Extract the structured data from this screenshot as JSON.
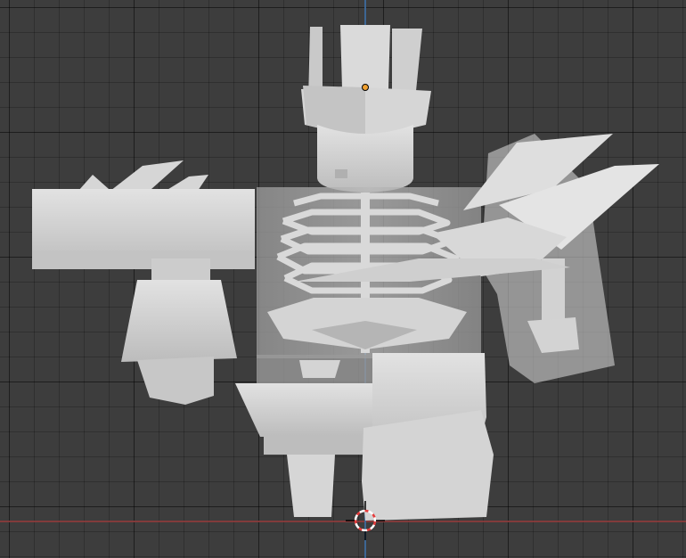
{
  "viewport": {
    "background_color": "#3d3d3d",
    "grid_color": "#2f2f2f",
    "x_axis_color": "#8a3b3b",
    "z_axis_color": "#3d6a9d"
  },
  "scene": {
    "model_color": "#d0d0d0",
    "model_shadow_color": "#a9a9a9",
    "origin_point_color": "#f0a030",
    "cursor_icon": "3d-cursor-icon",
    "objects": [
      "crown",
      "head",
      "torso",
      "rib-cage",
      "pelvis",
      "left-arm-block",
      "right-arm-bone",
      "wing-shroud",
      "left-leg",
      "right-leg-armor"
    ]
  }
}
